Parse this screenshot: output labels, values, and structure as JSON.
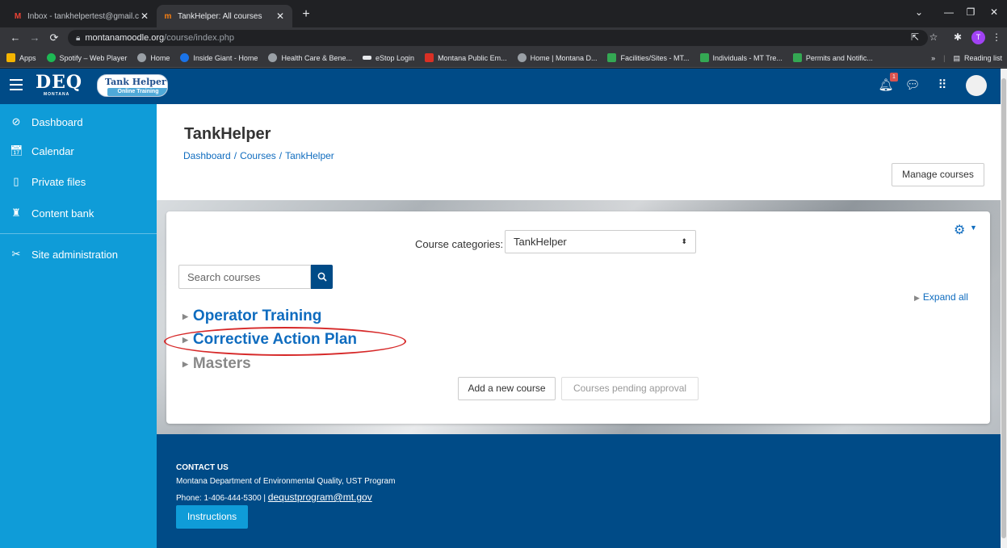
{
  "browser": {
    "tabs": [
      {
        "title": "Inbox - tankhelpertest@gmail.co",
        "icon": "gmail-icon"
      },
      {
        "title": "TankHelper: All courses",
        "icon": "moodle-icon"
      }
    ],
    "new_tab": "+",
    "url_host": "montanamoodle.org",
    "url_path": "/course/index.php",
    "profile_initial": "T",
    "bookmarks": [
      {
        "label": "Apps",
        "color": "#f4b400"
      },
      {
        "label": "Spotify – Web Player",
        "color": "#1db954"
      },
      {
        "label": "Home",
        "color": "#9aa0a6"
      },
      {
        "label": "Inside Giant - Home",
        "color": "#1a73e8"
      },
      {
        "label": "Health Care & Bene...",
        "color": "#9aa0a6"
      },
      {
        "label": "eStop Login",
        "color": "#e8eaed"
      },
      {
        "label": "Montana Public Em...",
        "color": "#d93025"
      },
      {
        "label": "Home | Montana D...",
        "color": "#9aa0a6"
      },
      {
        "label": "Facilities/Sites - MT...",
        "color": "#34a853"
      },
      {
        "label": "Individuals - MT Tre...",
        "color": "#34a853"
      },
      {
        "label": "Permits and Notific...",
        "color": "#34a853"
      }
    ],
    "bookmarks_more": "»",
    "reading_list": "Reading list"
  },
  "navbar": {
    "logo_text": "DEQ",
    "logo_subtext": "MONTANA",
    "badge_line1": "Tank Helper",
    "badge_line2": "Online Training",
    "notification_count": "1",
    "brand_color": "#004b87"
  },
  "sidebar": {
    "items": [
      {
        "label": "Dashboard",
        "icon": "dashboard-icon"
      },
      {
        "label": "Calendar",
        "icon": "calendar-icon"
      },
      {
        "label": "Private files",
        "icon": "file-icon"
      },
      {
        "label": "Content bank",
        "icon": "content-bank-icon"
      },
      {
        "label": "Site administration",
        "icon": "wrench-icon"
      }
    ],
    "color": "#0f9cd8"
  },
  "page": {
    "title": "TankHelper",
    "breadcrumb": [
      "Dashboard",
      "Courses",
      "TankHelper"
    ],
    "breadcrumb_sep": "/",
    "manage_courses": "Manage courses"
  },
  "card": {
    "category_label": "Course categories:",
    "category_selected": "TankHelper",
    "search_placeholder": "Search courses",
    "expand_all": "Expand all",
    "categories": [
      {
        "label": "Operator Training",
        "style": "blue"
      },
      {
        "label": "Corrective Action Plan",
        "style": "blue",
        "highlighted": true
      },
      {
        "label": "Masters",
        "style": "grey"
      }
    ],
    "add_course": "Add a new course",
    "pending": "Courses pending approval"
  },
  "footer": {
    "heading": "CONTACT US",
    "org": "Montana Department of Environmental Quality, UST Program",
    "phone": "Phone: 1-406-444-5300 |",
    "email": "dequstprogram@mt.gov",
    "instructions": "Instructions"
  }
}
